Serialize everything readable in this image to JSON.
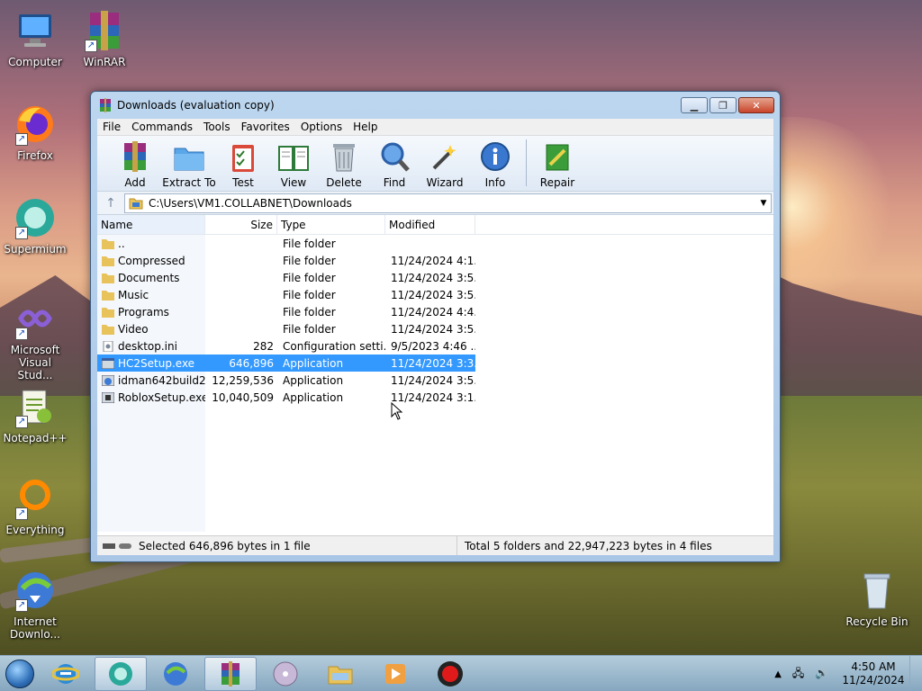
{
  "desktop": {
    "icons": [
      {
        "label": "Computer",
        "icon": "computer-icon"
      },
      {
        "label": "WinRAR",
        "icon": "winrar-icon"
      },
      {
        "label": "Firefox",
        "icon": "firefox-icon"
      },
      {
        "label": "Supermium",
        "icon": "supermium-icon"
      },
      {
        "label": "Microsoft Visual Stud...",
        "icon": "vscode-icon"
      },
      {
        "label": "Notepad++",
        "icon": "notepadpp-icon"
      },
      {
        "label": "Everything",
        "icon": "everything-icon"
      },
      {
        "label": "Internet Downlo...",
        "icon": "idm-icon"
      },
      {
        "label": "Recycle Bin",
        "icon": "recycle-bin-icon"
      }
    ]
  },
  "window": {
    "title": "Downloads (evaluation copy)",
    "menu": [
      "File",
      "Commands",
      "Tools",
      "Favorites",
      "Options",
      "Help"
    ],
    "toolbar": [
      {
        "label": "Add",
        "icon": "add-archive-icon"
      },
      {
        "label": "Extract To",
        "icon": "extract-folder-icon"
      },
      {
        "label": "Test",
        "icon": "test-clipboard-icon"
      },
      {
        "label": "View",
        "icon": "view-book-icon"
      },
      {
        "label": "Delete",
        "icon": "trash-icon"
      },
      {
        "label": "Find",
        "icon": "magnifier-icon"
      },
      {
        "label": "Wizard",
        "icon": "wand-icon"
      },
      {
        "label": "Info",
        "icon": "info-icon"
      },
      {
        "label": "Repair",
        "icon": "repair-icon"
      }
    ],
    "address": "C:\\Users\\VM1.COLLABNET\\Downloads",
    "columns": {
      "name": "Name",
      "size": "Size",
      "type": "Type",
      "modified": "Modified"
    },
    "files": [
      {
        "name": "..",
        "size": "",
        "type": "File folder",
        "modified": "",
        "kind": "folder"
      },
      {
        "name": "Compressed",
        "size": "",
        "type": "File folder",
        "modified": "11/24/2024 4:1...",
        "kind": "folder"
      },
      {
        "name": "Documents",
        "size": "",
        "type": "File folder",
        "modified": "11/24/2024 3:5...",
        "kind": "folder"
      },
      {
        "name": "Music",
        "size": "",
        "type": "File folder",
        "modified": "11/24/2024 3:5...",
        "kind": "folder"
      },
      {
        "name": "Programs",
        "size": "",
        "type": "File folder",
        "modified": "11/24/2024 4:4...",
        "kind": "folder"
      },
      {
        "name": "Video",
        "size": "",
        "type": "File folder",
        "modified": "11/24/2024 3:5...",
        "kind": "folder"
      },
      {
        "name": "desktop.ini",
        "size": "282",
        "type": "Configuration setti...",
        "modified": "9/5/2023 4:46 ...",
        "kind": "ini"
      },
      {
        "name": "HC2Setup.exe",
        "size": "646,896",
        "type": "Application",
        "modified": "11/24/2024 3:3...",
        "kind": "exe",
        "selected": true
      },
      {
        "name": "idman642build2...",
        "size": "12,259,536",
        "type": "Application",
        "modified": "11/24/2024 3:5...",
        "kind": "exe"
      },
      {
        "name": "RobloxSetup.exe",
        "size": "10,040,509",
        "type": "Application",
        "modified": "11/24/2024 3:1...",
        "kind": "exe"
      }
    ],
    "status_left": "Selected 646,896 bytes in 1 file",
    "status_right": "Total 5 folders and 22,947,223 bytes in 4 files"
  },
  "taskbar": {
    "apps": [
      "internet-explorer-icon",
      "supermium-icon",
      "idm-icon",
      "winrar-icon",
      "dvd-icon",
      "explorer-icon",
      "media-player-icon",
      "record-icon"
    ],
    "active": "winrar-icon",
    "time": "4:50 AM",
    "date": "11/24/2024"
  }
}
